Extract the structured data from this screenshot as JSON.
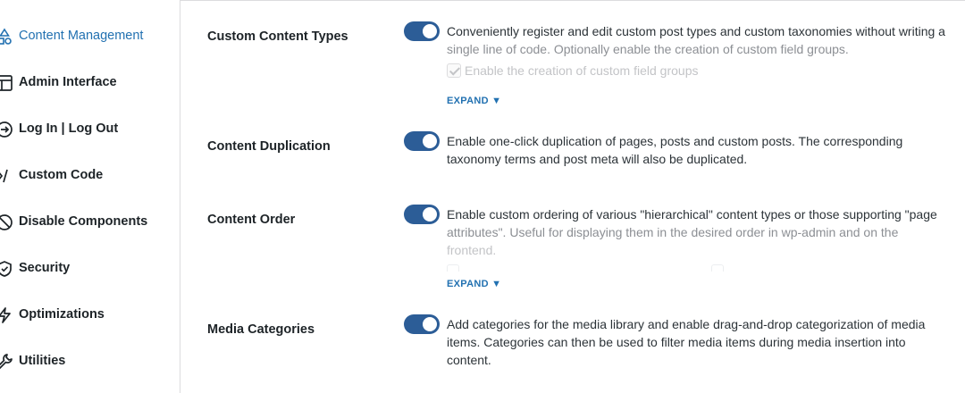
{
  "sidebar": {
    "items": [
      {
        "label": "Content Management",
        "icon": "content-management-icon",
        "active": true
      },
      {
        "label": "Admin Interface",
        "icon": "admin-interface-icon"
      },
      {
        "label": "Log In | Log Out",
        "icon": "login-logout-icon"
      },
      {
        "label": "Custom Code",
        "icon": "code-icon"
      },
      {
        "label": "Disable Components",
        "icon": "disable-icon"
      },
      {
        "label": "Security",
        "icon": "shield-icon"
      },
      {
        "label": "Optimizations",
        "icon": "lightning-icon"
      },
      {
        "label": "Utilities",
        "icon": "wrench-icon"
      }
    ]
  },
  "main": {
    "settings": [
      {
        "title": "Custom Content Types",
        "enabled": true,
        "description_line1": "Conveniently register and edit custom post types and custom taxonomies without writing a",
        "description_line2": "single line of code. Optionally enable the creation of custom field groups.",
        "sub_option": "Enable the creation of custom field groups",
        "expand_label": "EXPAND ▼"
      },
      {
        "title": "Content Duplication",
        "enabled": true,
        "description_line1": "Enable one-click duplication of pages, posts and custom posts. The corresponding",
        "description_line2": "taxonomy terms and post meta will also be duplicated."
      },
      {
        "title": "Content Order",
        "enabled": true,
        "description_line1": "Enable custom ordering of various \"hierarchical\" content types or those supporting \"page",
        "description_line2": "attributes\". Useful for displaying them in the desired order in wp-admin and on the",
        "description_line3": "frontend.",
        "expand_label": "EXPAND ▼"
      },
      {
        "title": "Media Categories",
        "enabled": true,
        "description_line1": "Add categories for the media library and enable drag-and-drop categorization of media",
        "description_line2": "items. Categories can then be used to filter media items during media insertion into",
        "description_line3": "content."
      }
    ]
  },
  "colors": {
    "accent": "#2271b1",
    "toggle_on": "#2c5d97",
    "border": "#dcdcde"
  }
}
